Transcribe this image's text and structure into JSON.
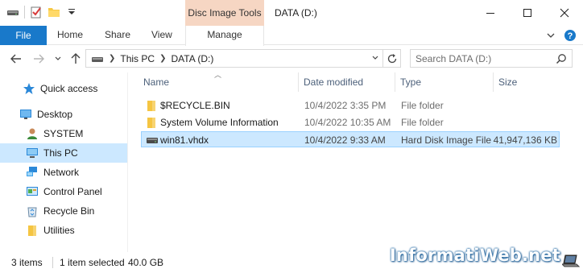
{
  "window": {
    "title": "DATA (D:)",
    "context_tab": "Disc Image Tools"
  },
  "ribbon": {
    "tabs": {
      "file": "File",
      "home": "Home",
      "share": "Share",
      "view": "View",
      "manage": "Manage"
    }
  },
  "address": {
    "crumbs": [
      "This PC",
      "DATA (D:)"
    ]
  },
  "search": {
    "placeholder": "Search DATA (D:)"
  },
  "nav": {
    "items": [
      {
        "label": "Quick access",
        "icon": "star-icon"
      },
      {
        "label": "Desktop",
        "icon": "desktop-folder-icon"
      },
      {
        "label": "SYSTEM",
        "icon": "user-icon"
      },
      {
        "label": "This PC",
        "icon": "computer-icon",
        "selected": true
      },
      {
        "label": "Network",
        "icon": "network-icon"
      },
      {
        "label": "Control Panel",
        "icon": "control-panel-icon"
      },
      {
        "label": "Recycle Bin",
        "icon": "recycle-bin-icon"
      },
      {
        "label": "Utilities",
        "icon": "folder-icon"
      }
    ]
  },
  "columns": {
    "name": "Name",
    "date": "Date modified",
    "type": "Type",
    "size": "Size"
  },
  "files": [
    {
      "name": "$RECYCLE.BIN",
      "date": "10/4/2022 3:35 PM",
      "type": "File folder",
      "size": "",
      "icon": "folder-icon"
    },
    {
      "name": "System Volume Information",
      "date": "10/4/2022 10:35 AM",
      "type": "File folder",
      "size": "",
      "icon": "folder-icon"
    },
    {
      "name": "win81.vhdx",
      "date": "10/4/2022 9:33 AM",
      "type": "Hard Disk Image File",
      "size": "41,947,136 KB",
      "icon": "disk-image-icon",
      "selected": true
    }
  ],
  "status": {
    "count": "3 items",
    "selected": "1 item selected",
    "size": "40.0 GB"
  },
  "watermark": "InformatiWeb.net",
  "colors": {
    "accent": "#1979ca",
    "selection": "#cce8ff",
    "context_tab": "#f6d6c3"
  }
}
